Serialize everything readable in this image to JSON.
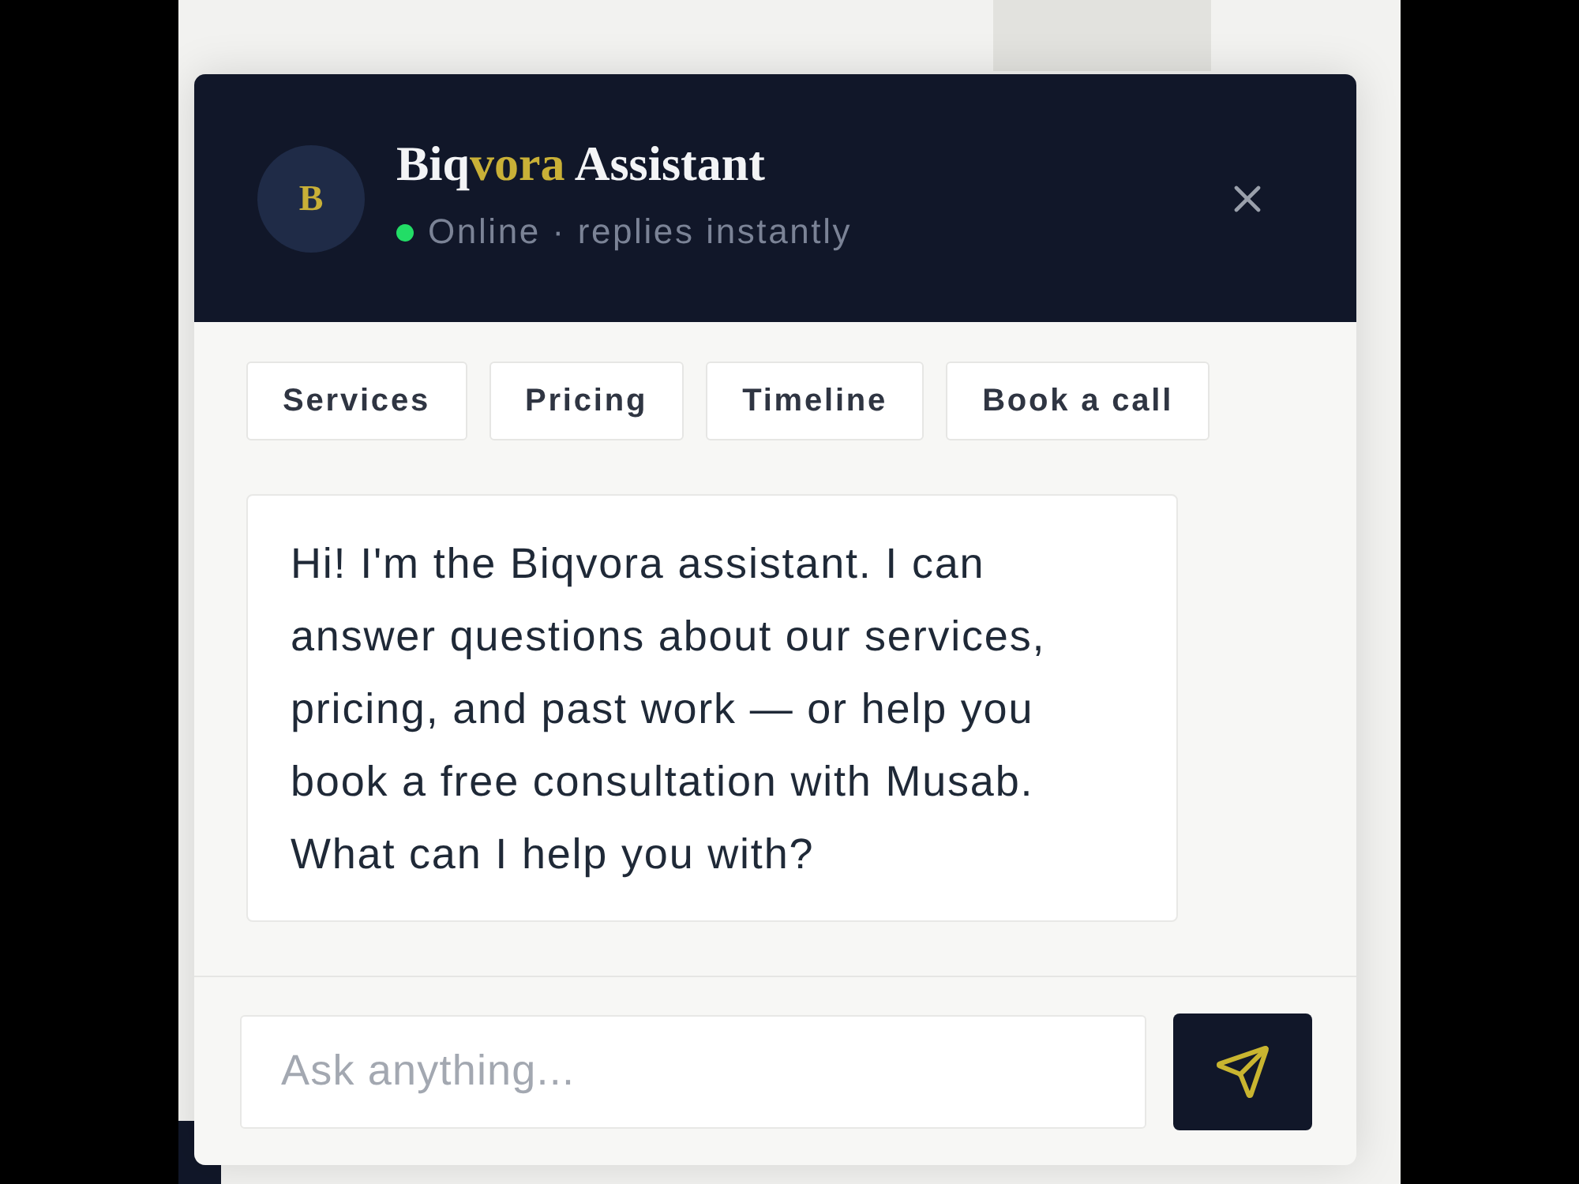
{
  "header": {
    "avatar_letter": "B",
    "title": [
      {
        "text": "Biq",
        "highlight": false
      },
      {
        "text": "vora",
        "highlight": true
      },
      {
        "text": " Assistant",
        "highlight": false
      }
    ],
    "status": {
      "online": true,
      "text": "Online · replies instantly"
    }
  },
  "quick_replies": [
    "Services",
    "Pricing",
    "Timeline",
    "Book a call"
  ],
  "messages": [
    {
      "kind": "received",
      "text": "Hi! I'm the Biqvora assistant. I can answer questions about our services, pricing, and past work — or help you book a free consultation with Musab. What can I help you with?"
    }
  ],
  "composer": {
    "placeholder": "Ask anything..."
  }
}
